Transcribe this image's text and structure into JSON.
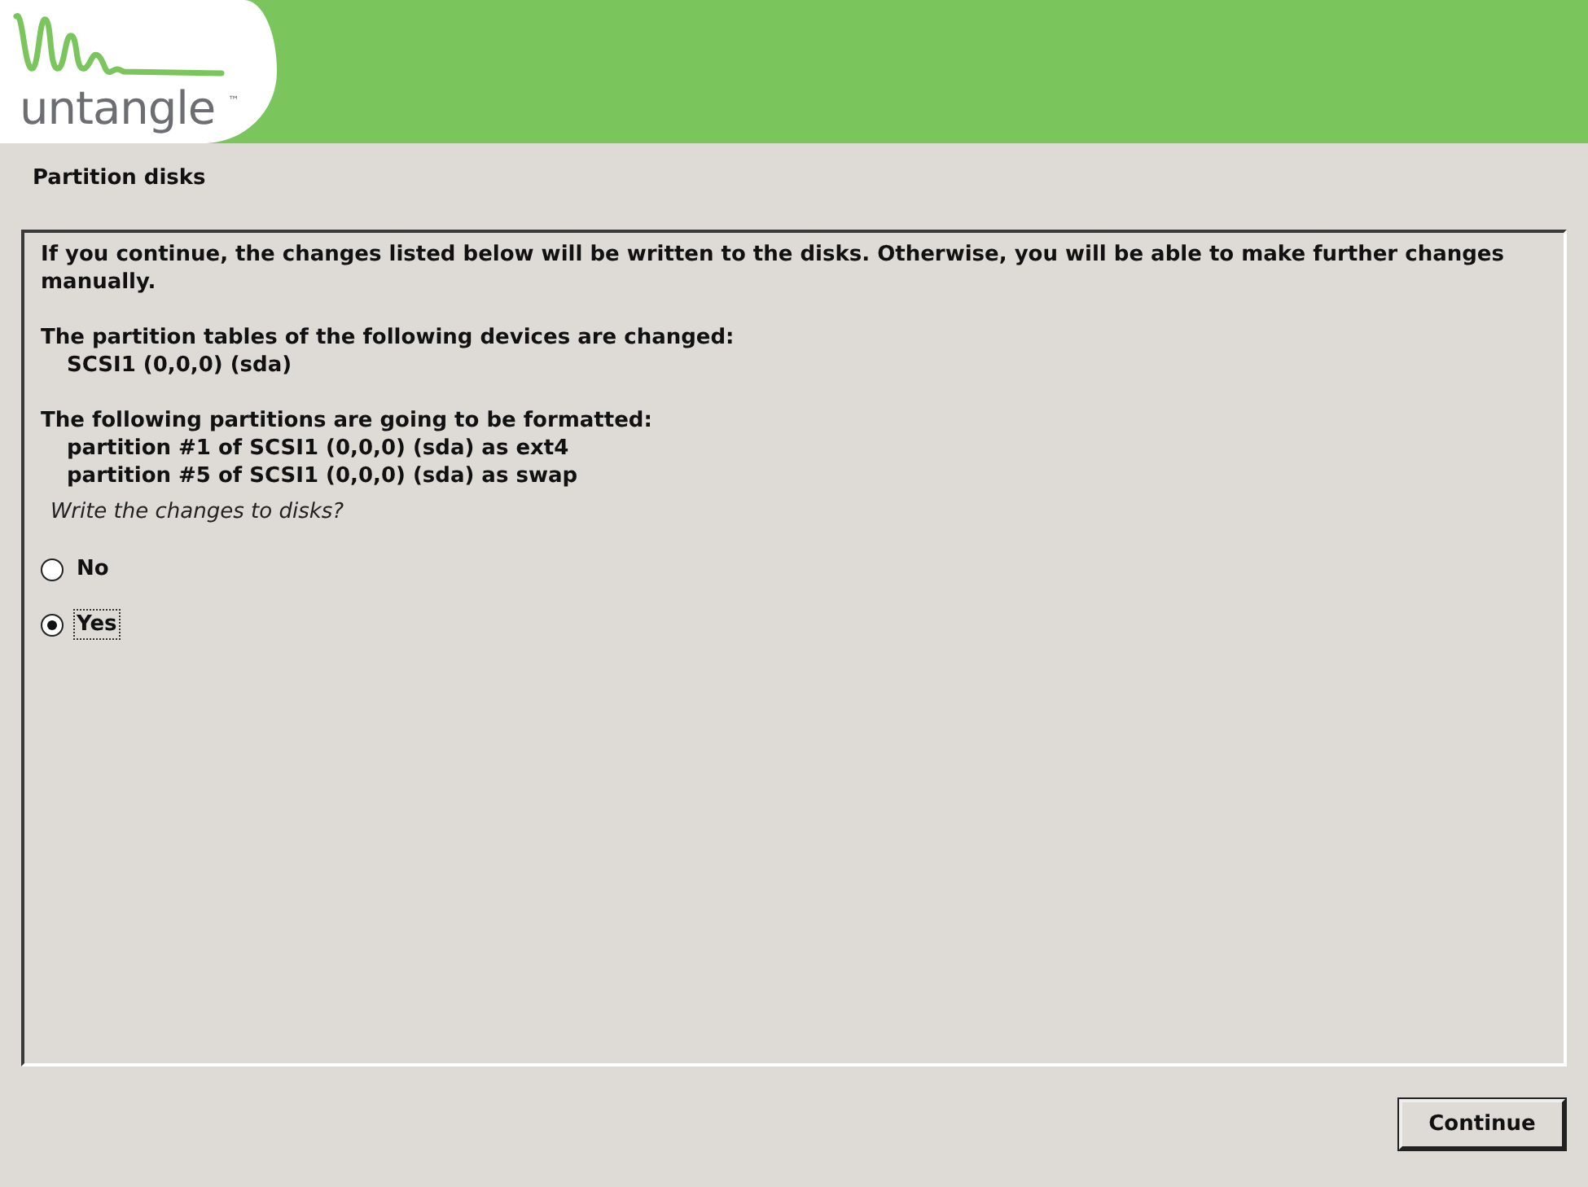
{
  "logo": {
    "wordmark": "untangle",
    "trademark": "™"
  },
  "title": "Partition disks",
  "message": {
    "intro": "If you continue, the changes listed below will be written to the disks. Otherwise, you will be able to make further changes manually.",
    "sections": [
      {
        "heading": "The partition tables of the following devices are changed:",
        "items": [
          "SCSI1 (0,0,0) (sda)"
        ]
      },
      {
        "heading": "The following partitions are going to be formatted:",
        "items": [
          "partition #1 of SCSI1 (0,0,0) (sda) as ext4",
          "partition #5 of SCSI1 (0,0,0) (sda) as swap"
        ]
      }
    ]
  },
  "question": "Write the changes to disks?",
  "options": [
    {
      "label": "No",
      "selected": false
    },
    {
      "label": "Yes",
      "selected": true
    }
  ],
  "buttons": [
    {
      "label": "Continue"
    }
  ]
}
